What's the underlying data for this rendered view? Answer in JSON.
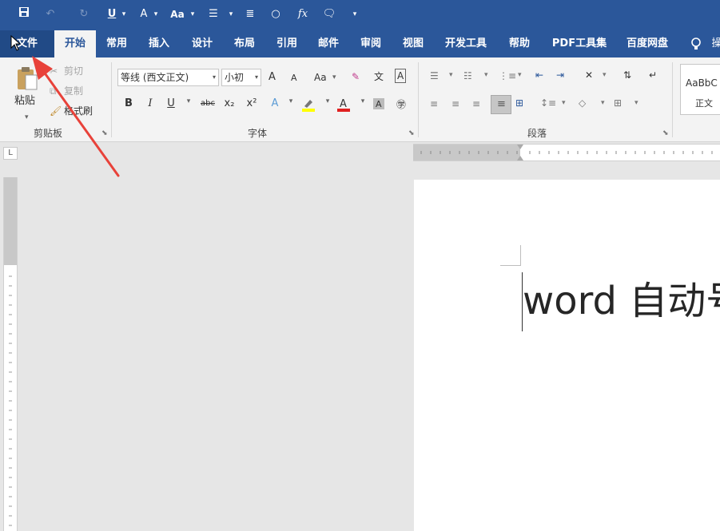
{
  "quick_access": {
    "save_icon": "save-icon",
    "undo_icon": "undo-icon",
    "redo_icon": "redo-icon",
    "underline_label": "U",
    "text_effects_label": "A",
    "font_case_label": "Aa",
    "bullets_icon": "list-icon",
    "align_icon": "align-icon",
    "shape_icon": "circle-icon",
    "formula_label": "fx",
    "comment_icon": "comment-icon",
    "customize_icon": "chevron-down-icon"
  },
  "tabs": [
    {
      "label": "文件"
    },
    {
      "label": "开始"
    },
    {
      "label": "常用"
    },
    {
      "label": "插入"
    },
    {
      "label": "设计"
    },
    {
      "label": "布局"
    },
    {
      "label": "引用"
    },
    {
      "label": "邮件"
    },
    {
      "label": "审阅"
    },
    {
      "label": "视图"
    },
    {
      "label": "开发工具"
    },
    {
      "label": "帮助"
    },
    {
      "label": "PDF工具集"
    },
    {
      "label": "百度网盘"
    },
    {
      "label": "操"
    }
  ],
  "clipboard": {
    "paste": "粘贴",
    "cut": "剪切",
    "copy": "复制",
    "format_painter": "格式刷",
    "group_label": "剪贴板"
  },
  "font": {
    "font_name": "等线 (西文正文)",
    "font_size": "小初",
    "grow": "A",
    "shrink": "A",
    "change_case": "Aa",
    "bold": "B",
    "italic": "I",
    "underline": "U",
    "strikethrough": "abc",
    "subscript": "x₂",
    "superscript": "x²",
    "group_label": "字体"
  },
  "paragraph": {
    "group_label": "段落"
  },
  "styles": {
    "preview": "AaBbC",
    "normal": "正文"
  },
  "ruler_corner": "L",
  "document": {
    "text": "word 自动号"
  },
  "colors": {
    "ribbon_blue": "#2b579a",
    "annotation_arrow": "#e8423a",
    "highlight_yellow": "#ffff00",
    "font_color_red": "#e02020"
  }
}
